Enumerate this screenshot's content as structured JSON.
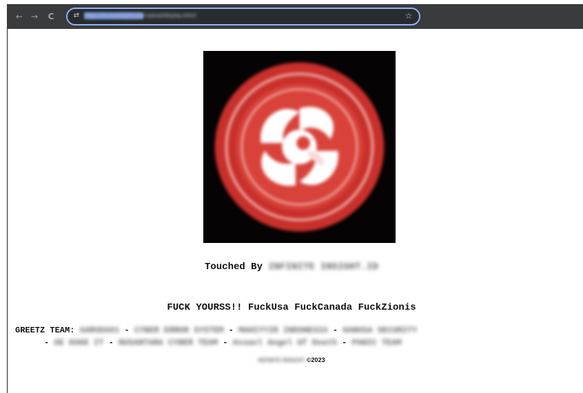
{
  "browser": {
    "back_icon": "←",
    "forward_icon": "→",
    "reload_icon": "C",
    "site_info_icon": "⇄",
    "url": "https://ex.mock/pb/index/upload/display.shtml",
    "bookmark_icon": "☆"
  },
  "page": {
    "logo": {
      "description_icon": "red-circular-emblem-with-white-swirl",
      "colors": {
        "background": "#050303",
        "ring": "#c9302c",
        "inner": "#d8423a",
        "swirl": "#ffffff"
      }
    },
    "touched_prefix": "Touched By",
    "touched_by": "INFINITE INSIGHT.ID",
    "slogan": "FUCK YOURSS!! FuckUsa FuckCanada FuckZionis",
    "greetz_label": "GREETZ TEAM:",
    "greetz_teams_line1": [
      "GARUDA01",
      "CYBER ERROR SYSTEM",
      "MAHIYYIR INDONESIA",
      "GANOSA SECURITY"
    ],
    "greetz_teams_line2": [
      "GE KOGE IT",
      "NUSANTARA CYBER TEAM",
      "Assael Angel Of Death",
      "PANIC TEAM"
    ],
    "separator": "-",
    "footer_name": "INFINITE INSIGHT",
    "footer_copyright": "©2023"
  }
}
